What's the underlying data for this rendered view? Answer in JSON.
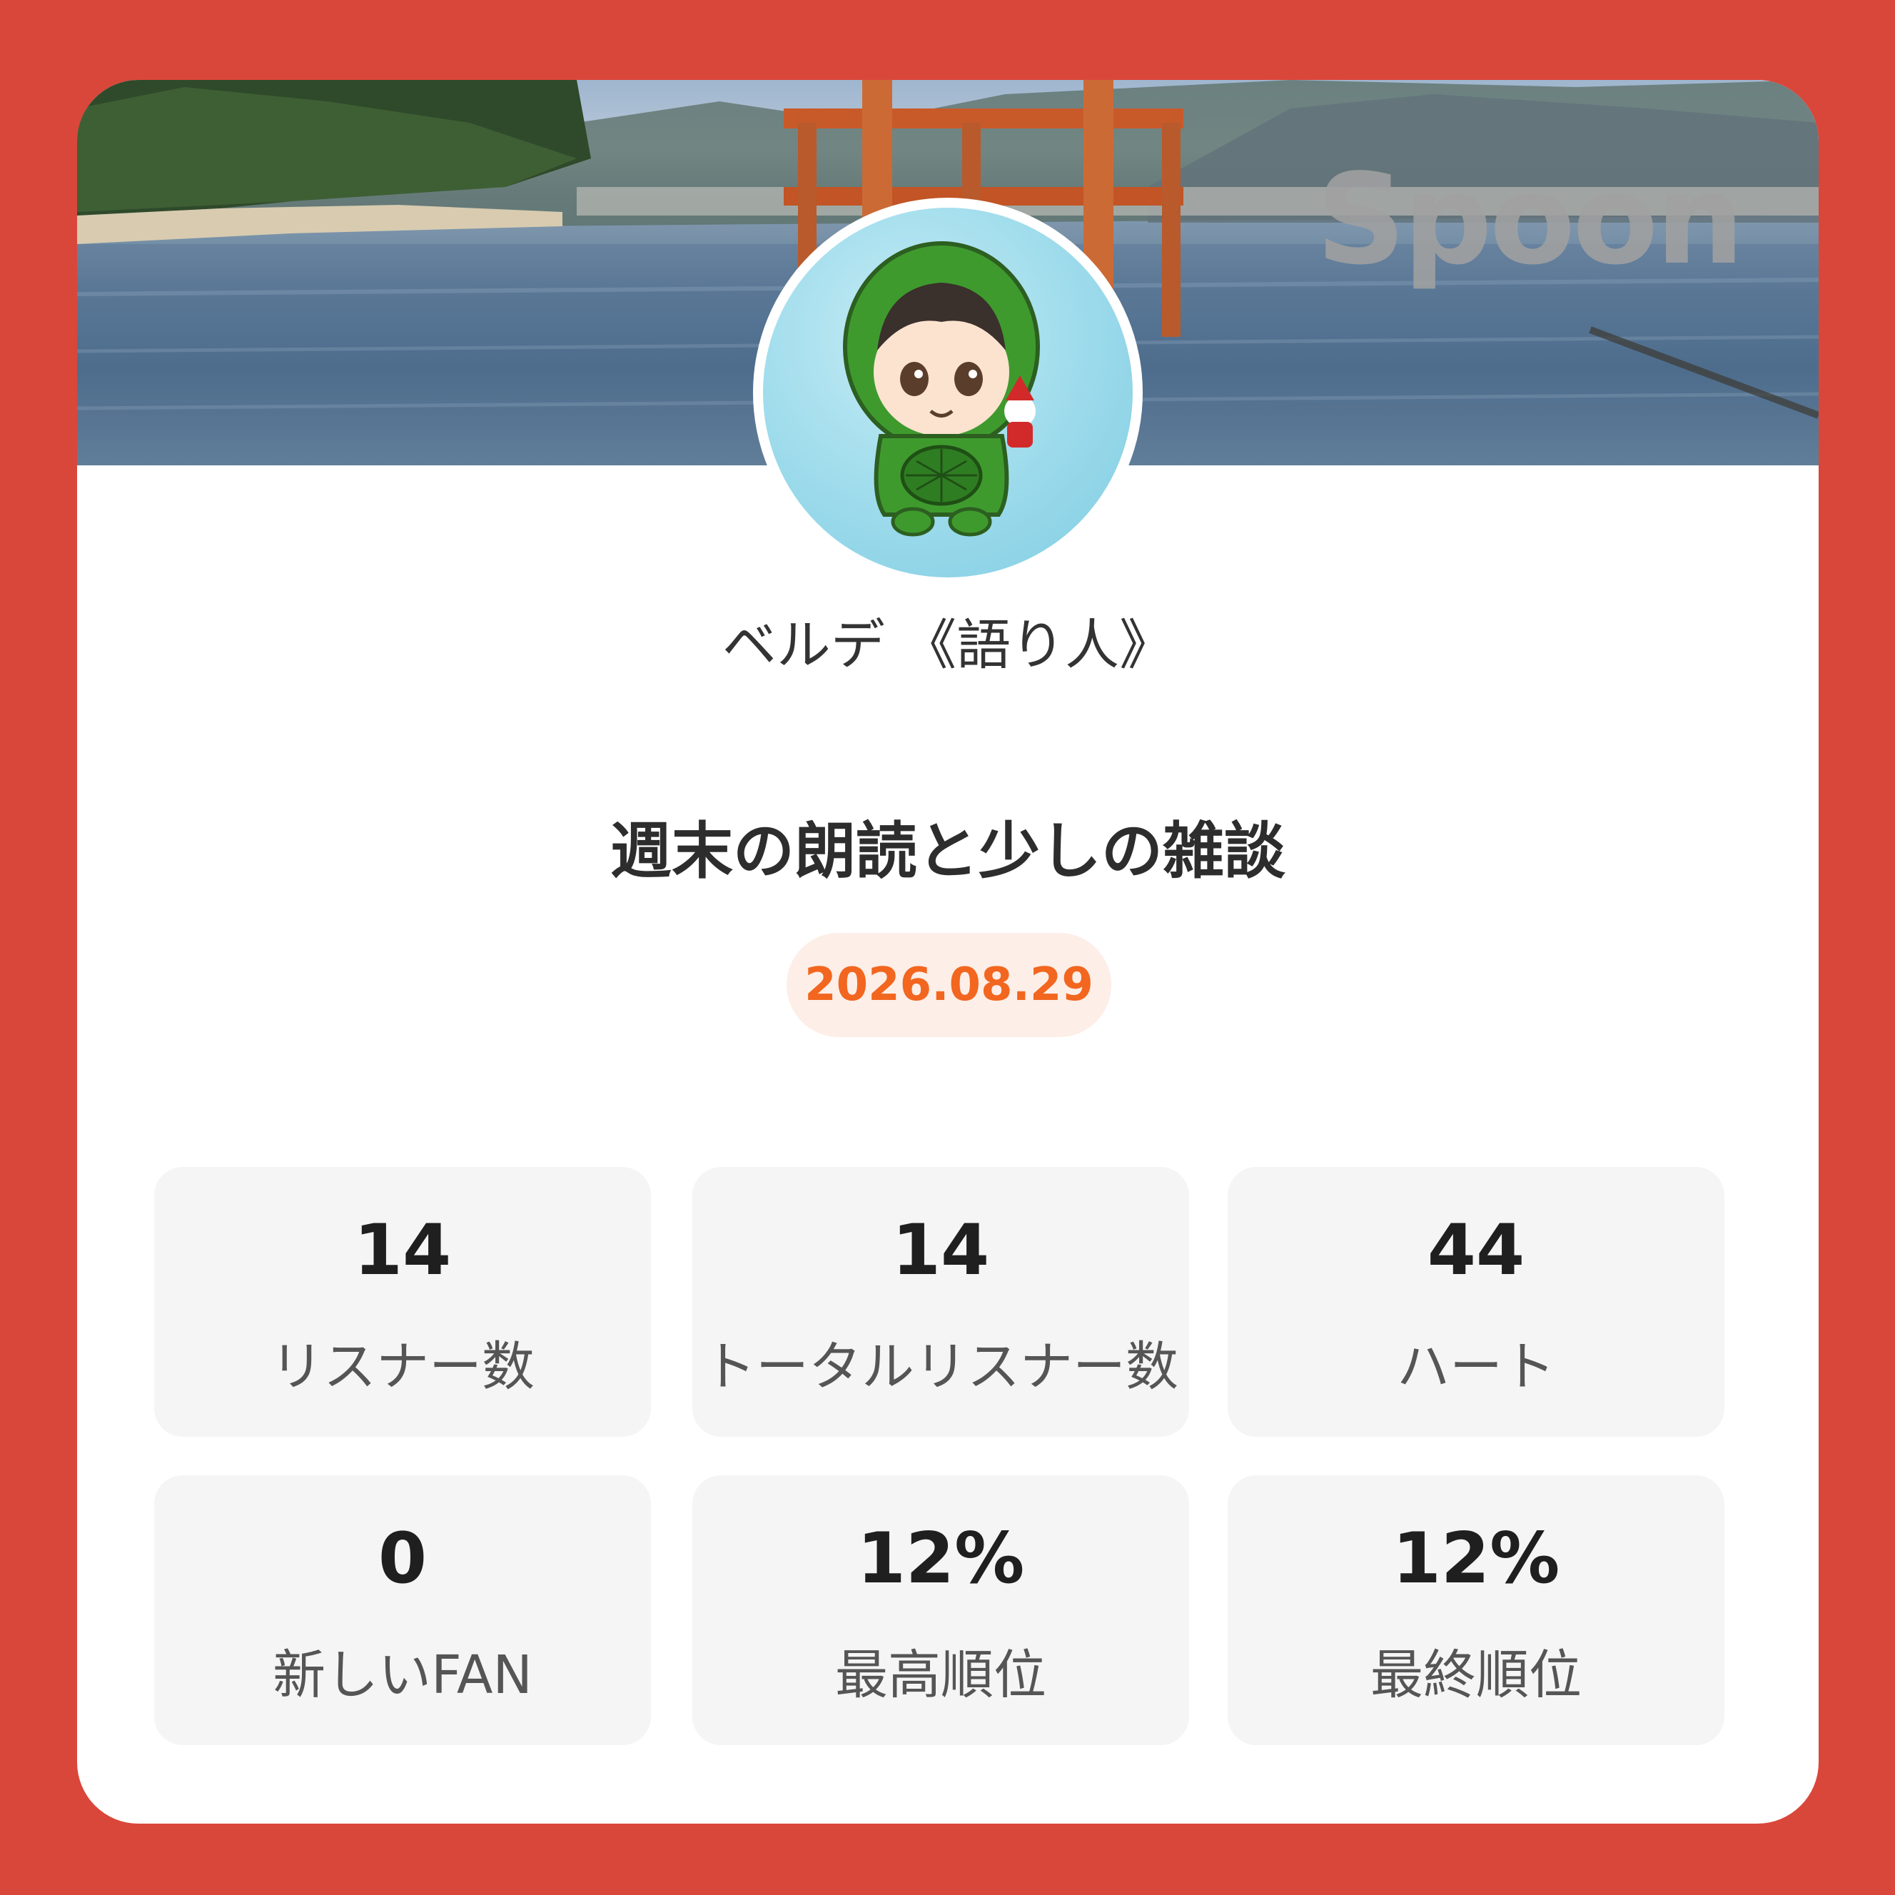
{
  "brand": {
    "logo_text": "Spoon"
  },
  "profile": {
    "username": "ベルデ 《語り人》"
  },
  "broadcast": {
    "title": "週末の朗読と少しの雑談",
    "date": "2026.08.29"
  },
  "colors": {
    "background": "#d9473a",
    "accent": "#f2661f",
    "pill_bg": "#fdeee7"
  },
  "stats": [
    {
      "value": "14",
      "label": "リスナー数"
    },
    {
      "value": "14",
      "label": "トータルリスナー数"
    },
    {
      "value": "44",
      "label": "ハート"
    },
    {
      "value": "0",
      "label": "新しいFAN"
    },
    {
      "value": "12%",
      "label": "最高順位"
    },
    {
      "value": "12%",
      "label": "最終順位"
    }
  ]
}
